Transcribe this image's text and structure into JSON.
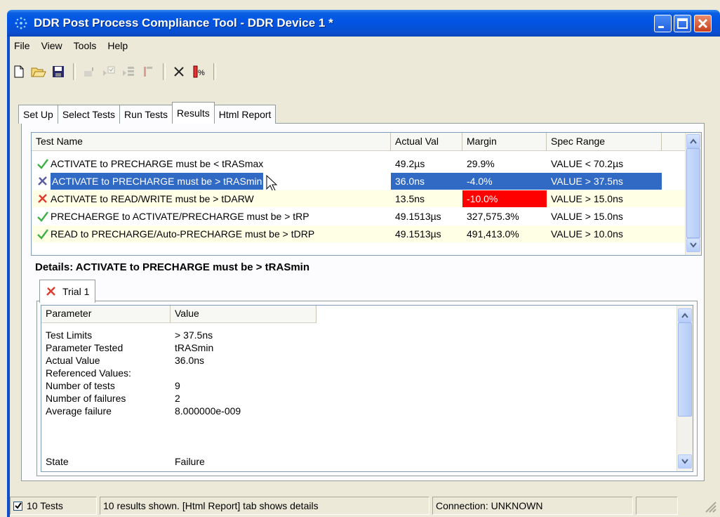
{
  "window": {
    "title": "DDR Post Process Compliance Tool - DDR Device 1 *"
  },
  "menu": [
    "File",
    "View",
    "Tools",
    "Help"
  ],
  "toolbar": {
    "icons": [
      "new-file-icon",
      "open-folder-icon",
      "save-icon",
      "export-icon",
      "run-selected-icon",
      "run-list-icon",
      "stop-icon",
      "delete-icon",
      "margin-icon"
    ]
  },
  "tabs": [
    {
      "label": "Set Up"
    },
    {
      "label": "Select Tests"
    },
    {
      "label": "Run Tests"
    },
    {
      "label": "Results"
    },
    {
      "label": "Html Report"
    }
  ],
  "results": {
    "columns": [
      "Test Name",
      "Actual Val",
      "Margin",
      "Spec Range"
    ],
    "rows": [
      {
        "status": "pass",
        "name": "ACTIVATE to PRECHARGE must be < tRASmax",
        "actual": "49.2µs",
        "margin": "29.9%",
        "spec": "VALUE < 70.2µs"
      },
      {
        "status": "fail",
        "name": "ACTIVATE to PRECHARGE must be > tRASmin",
        "actual": "36.0ns",
        "margin": "-4.0%",
        "spec": "VALUE > 37.5ns"
      },
      {
        "status": "fail",
        "name": "ACTIVATE to READ/WRITE must be > tDARW",
        "actual": "13.5ns",
        "margin": "-10.0%",
        "spec": "VALUE > 15.0ns"
      },
      {
        "status": "pass",
        "name": "PRECHAERGE to ACTIVATE/PRECHARGE must be > tRP",
        "actual": "49.1513µs",
        "margin": "327,575.3%",
        "spec": "VALUE > 15.0ns"
      },
      {
        "status": "pass",
        "name": "READ to PRECHARGE/Auto-PRECHARGE must be > tDRP",
        "actual": "49.1513µs",
        "margin": "491,413.0%",
        "spec": "VALUE > 10.0ns"
      }
    ]
  },
  "details": {
    "title": "Details: ACTIVATE to PRECHARGE must be > tRASmin",
    "trial_tab": "Trial 1",
    "columns": [
      "Parameter",
      "Value"
    ],
    "rows": [
      {
        "p": "Test Limits",
        "v": "> 37.5ns"
      },
      {
        "p": "Parameter Tested",
        "v": "tRASmin"
      },
      {
        "p": "Actual Value",
        "v": "36.0ns"
      },
      {
        "p": "Referenced Values:",
        "v": ""
      },
      {
        "p": "Number of tests",
        "v": "9"
      },
      {
        "p": "Number of failures",
        "v": "2"
      },
      {
        "p": "Average failure",
        "v": "8.000000e-009"
      },
      {
        "p": "",
        "v": ""
      },
      {
        "p": "State",
        "v": "Failure"
      }
    ]
  },
  "status": {
    "tests": "10 Tests",
    "message": "10 results shown. [Html Report] tab shows details",
    "connection": "Connection: UNKNOWN"
  },
  "colors": {
    "pass": "#3cb043",
    "fail": "#e03a2a",
    "selection": "#316ac5",
    "margin_fail": "#ff0000",
    "alt_row": "#ffffe6"
  }
}
